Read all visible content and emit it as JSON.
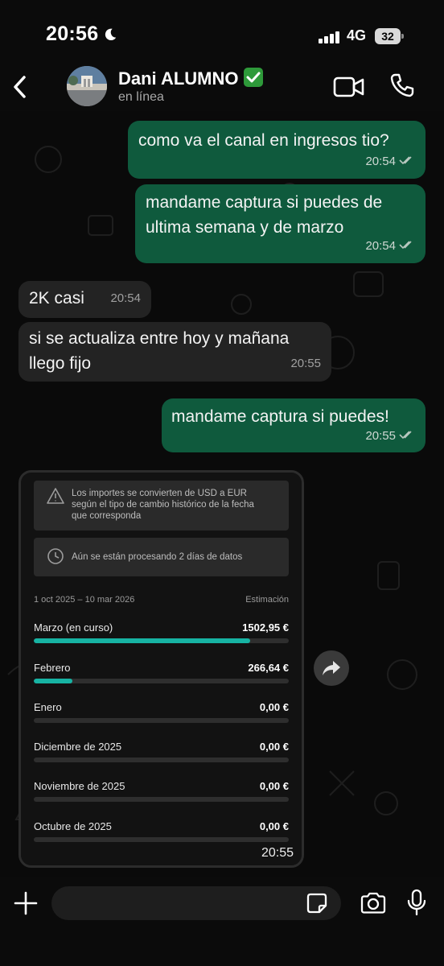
{
  "status_bar": {
    "time": "20:56",
    "network": "4G",
    "battery": "32"
  },
  "header": {
    "contact_name": "Dani ALUMNO",
    "contact_status": "en línea"
  },
  "messages": [
    {
      "direction": "out",
      "text": "como va el canal en ingresos tio?",
      "time": "20:54"
    },
    {
      "direction": "out",
      "text": "mandame captura si puedes de ultima semana y de marzo",
      "time": "20:54"
    },
    {
      "direction": "in",
      "text": "2K casi",
      "time": "20:54"
    },
    {
      "direction": "in",
      "text": "si se actualiza entre hoy y mañana llego fijo",
      "time": "20:55"
    },
    {
      "direction": "out",
      "text": "mandame captura si puedes!",
      "time": "20:55"
    }
  ],
  "image_message": {
    "time": "20:55",
    "notice_currency": "Los importes se convierten de USD a EUR según el tipo de cambio histórico de la fecha que corresponda",
    "notice_processing": "Aún se están procesando 2 días de datos",
    "date_range": "1 oct 2025 – 10 mar 2026",
    "estimate_label": "Estimación",
    "months": [
      {
        "name": "Marzo (en curso)",
        "value": "1502,95 €",
        "fraction": 0.85
      },
      {
        "name": "Febrero",
        "value": "266,64 €",
        "fraction": 0.15
      },
      {
        "name": "Enero",
        "value": "0,00 €",
        "fraction": 0
      },
      {
        "name": "Diciembre de 2025",
        "value": "0,00 €",
        "fraction": 0
      },
      {
        "name": "Noviembre de 2025",
        "value": "0,00 €",
        "fraction": 0
      },
      {
        "name": "Octubre de 2025",
        "value": "0,00 €",
        "fraction": 0
      }
    ]
  },
  "input": {
    "placeholder": ""
  },
  "colors": {
    "outgoing_bubble": "#0f5a3d",
    "incoming_bubble": "#232323",
    "progress_fill": "#17b3a3",
    "verified_badge": "#2e9a3a"
  }
}
